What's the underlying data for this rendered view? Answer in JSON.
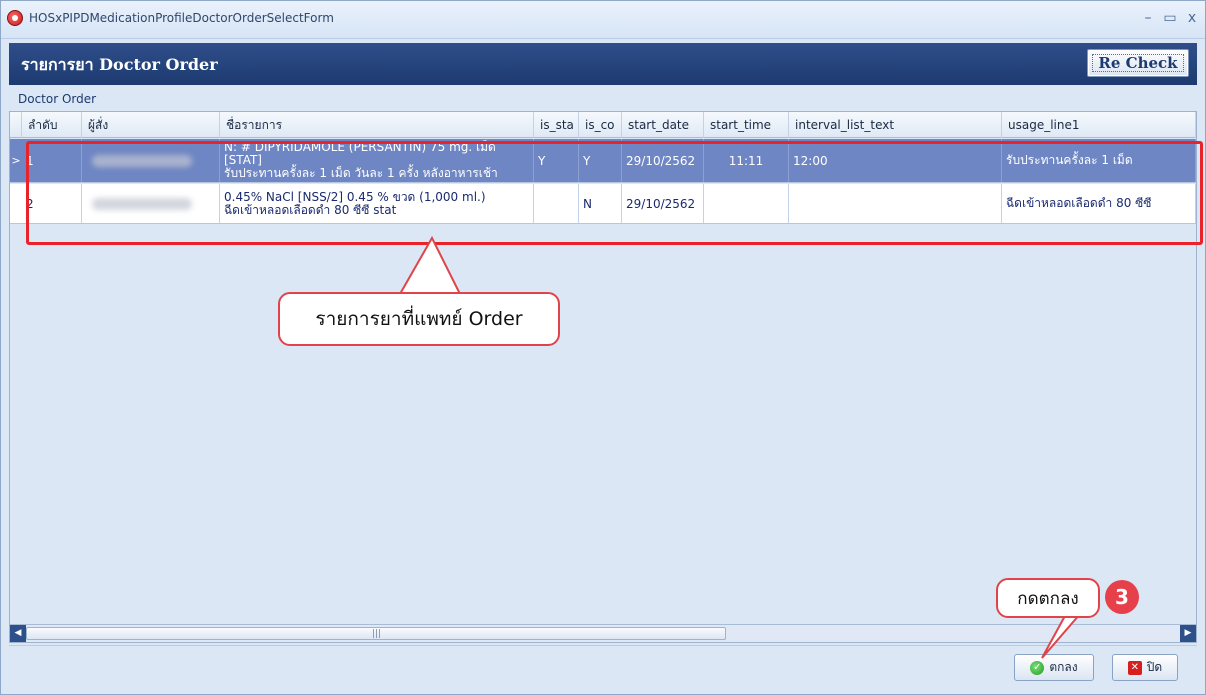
{
  "window": {
    "title": "HOSxPIPDMedicationProfileDoctorOrderSelectForm",
    "controls": {
      "minimize": "–",
      "maximize": "▭",
      "close": "x"
    }
  },
  "header": {
    "title": "รายการยา Doctor Order",
    "recheck_label": "Re Check"
  },
  "group_label": "Doctor Order",
  "grid": {
    "columns": [
      "ลำดับ",
      "ผู้สั่ง",
      "ชื่อรายการ",
      "is_sta",
      "is_co",
      "start_date",
      "start_time",
      "interval_list_text",
      "usage_line1"
    ],
    "rows": [
      {
        "marker": ">",
        "order_no": "1",
        "name_lines": [
          "N: # DIPYRIDAMOLE (PERSANTIN) 75 mg. เม็ด",
          "[STAT]",
          "รับประทานครั้งละ 1 เม็ด วันละ 1 ครั้ง หลังอาหารเช้า"
        ],
        "is_sta": "Y",
        "is_co": "Y",
        "start_date": "29/10/2562",
        "start_time": "11:11",
        "interval_list_text": "12:00",
        "usage_line1": "รับประทานครั้งละ 1 เม็ด"
      },
      {
        "marker": "",
        "order_no": "2",
        "name_lines": [
          "0.45% NaCl [NSS/2] 0.45 % ขวด (1,000 ml.)",
          "ฉีดเข้าหลอดเลือดดำ 80 ซีซี stat"
        ],
        "is_sta": "",
        "is_co": "N",
        "start_date": "29/10/2562",
        "start_time": "",
        "interval_list_text": "",
        "usage_line1": "ฉีดเข้าหลอดเลือดดำ 80 ซีซี"
      }
    ]
  },
  "footer": {
    "ok_label": "ตกลง",
    "close_label": "ปิด"
  },
  "annotations": {
    "callout_main": "รายการยาที่แพทย์ Order",
    "callout_ok": "กดตกลง",
    "step_number": "3",
    "highlight_color": "#e8232a"
  }
}
